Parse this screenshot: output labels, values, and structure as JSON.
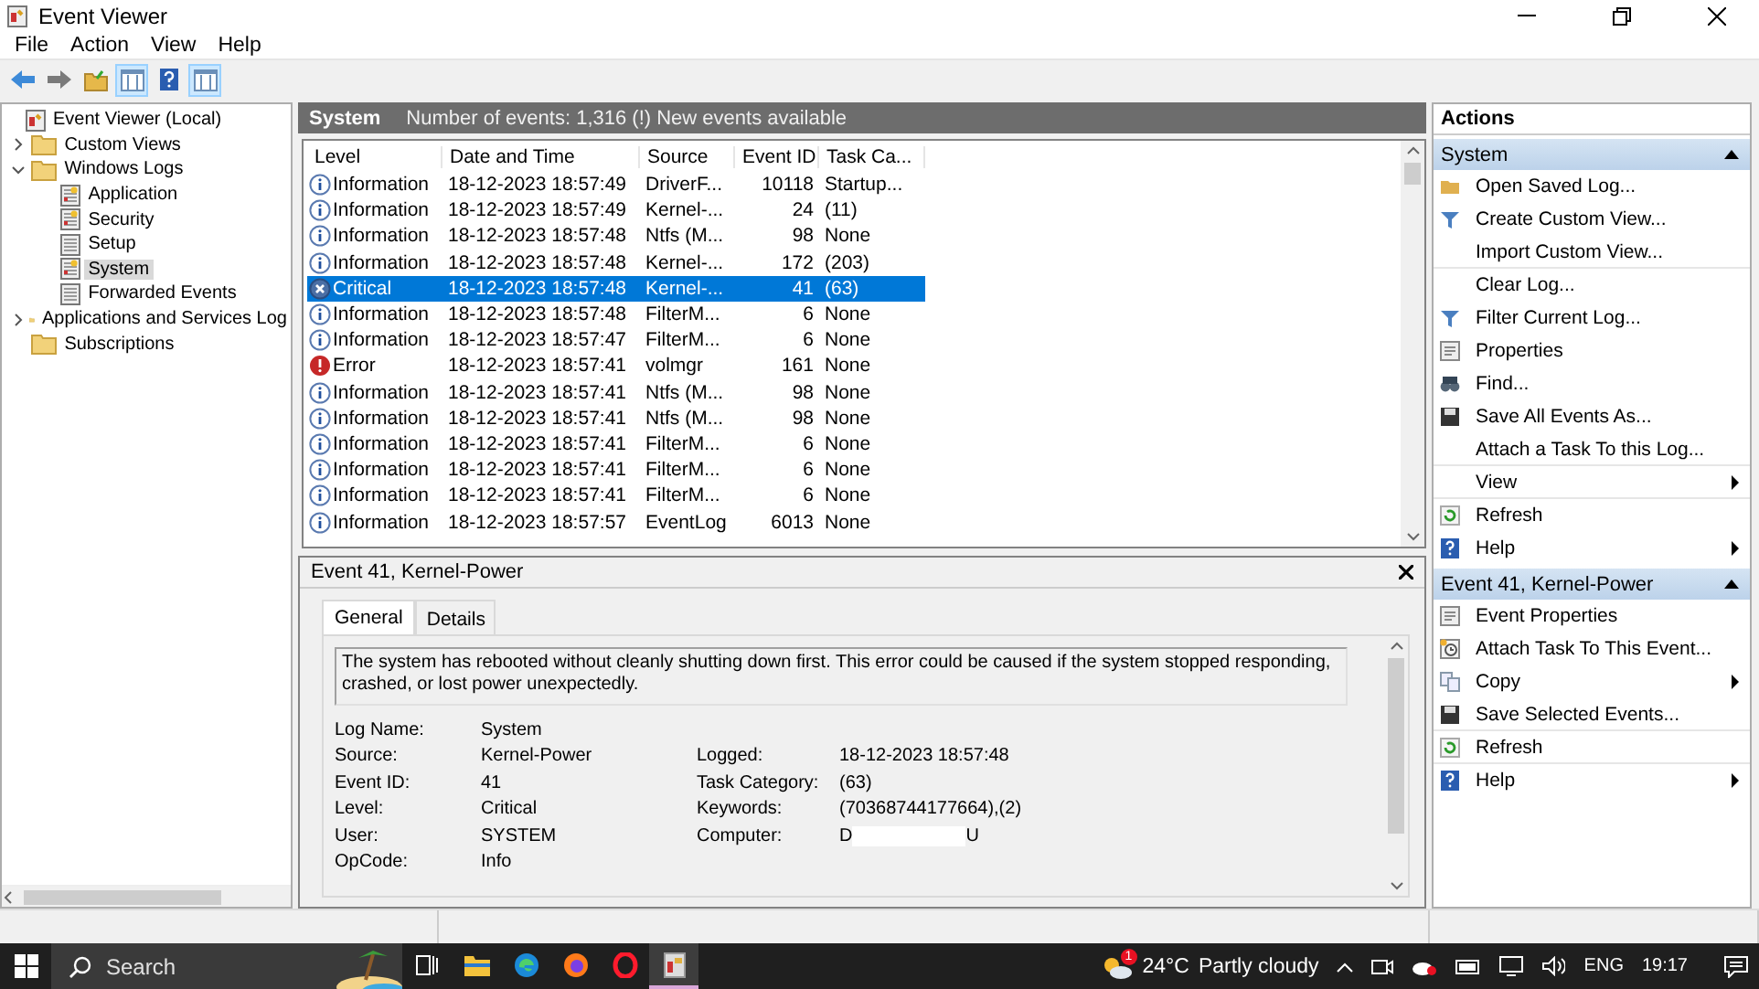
{
  "window": {
    "title": "Event Viewer"
  },
  "menu": [
    {
      "label": "File"
    },
    {
      "label": "Action"
    },
    {
      "label": "View"
    },
    {
      "label": "Help"
    }
  ],
  "toolbar": [
    {
      "kind": "back",
      "pressed": false
    },
    {
      "kind": "forward",
      "pressed": false
    },
    {
      "kind": "folder",
      "pressed": false
    },
    {
      "kind": "pane",
      "pressed": true
    },
    {
      "kind": "help",
      "pressed": false
    },
    {
      "kind": "pane",
      "pressed": true
    }
  ],
  "tree": [
    {
      "label": "Event Viewer (Local)",
      "kind": "root",
      "selected": false,
      "children": [
        {
          "label": "Custom Views",
          "kind": "folder",
          "expanded": false,
          "selected": false
        },
        {
          "label": "Windows Logs",
          "kind": "folder",
          "expanded": true,
          "selected": false,
          "children": [
            {
              "label": "Application",
              "kind": "log",
              "selected": false
            },
            {
              "label": "Security",
              "kind": "log",
              "selected": false
            },
            {
              "label": "Setup",
              "kind": "plain",
              "selected": false
            },
            {
              "label": "System",
              "kind": "log",
              "selected": true
            },
            {
              "label": "Forwarded Events",
              "kind": "plain",
              "selected": false
            }
          ]
        },
        {
          "label": "Applications and Services Log",
          "kind": "folder",
          "expanded": false,
          "selected": false
        },
        {
          "label": "Subscriptions",
          "kind": "folder",
          "selected": false
        }
      ]
    }
  ],
  "log_header": {
    "title": "System",
    "summary": "Number of events: 1,316 (!) New events available"
  },
  "table": {
    "columns": [
      "Level",
      "Date and Time",
      "Source",
      "Event ID",
      "Task Ca..."
    ],
    "rows": [
      {
        "kind": "information",
        "level": "Information",
        "date": "18-12-2023 18:57:49",
        "source": "DriverF...",
        "event_id": "10118",
        "task": "Startup...",
        "selected": false
      },
      {
        "kind": "information",
        "level": "Information",
        "date": "18-12-2023 18:57:49",
        "source": "Kernel-...",
        "event_id": "24",
        "task": "(11)",
        "selected": false
      },
      {
        "kind": "information",
        "level": "Information",
        "date": "18-12-2023 18:57:48",
        "source": "Ntfs (M...",
        "event_id": "98",
        "task": "None",
        "selected": false
      },
      {
        "kind": "information",
        "level": "Information",
        "date": "18-12-2023 18:57:48",
        "source": "Kernel-...",
        "event_id": "172",
        "task": "(203)",
        "selected": false
      },
      {
        "kind": "critical",
        "level": "Critical",
        "date": "18-12-2023 18:57:48",
        "source": "Kernel-...",
        "event_id": "41",
        "task": "(63)",
        "selected": true
      },
      {
        "kind": "information",
        "level": "Information",
        "date": "18-12-2023 18:57:48",
        "source": "FilterM...",
        "event_id": "6",
        "task": "None",
        "selected": false
      },
      {
        "kind": "information",
        "level": "Information",
        "date": "18-12-2023 18:57:47",
        "source": "FilterM...",
        "event_id": "6",
        "task": "None",
        "selected": false
      },
      {
        "kind": "error",
        "level": "Error",
        "date": "18-12-2023 18:57:41",
        "source": "volmgr",
        "event_id": "161",
        "task": "None",
        "selected": false
      },
      {
        "kind": "information",
        "level": "Information",
        "date": "18-12-2023 18:57:41",
        "source": "Ntfs (M...",
        "event_id": "98",
        "task": "None",
        "selected": false
      },
      {
        "kind": "information",
        "level": "Information",
        "date": "18-12-2023 18:57:41",
        "source": "Ntfs (M...",
        "event_id": "98",
        "task": "None",
        "selected": false
      },
      {
        "kind": "information",
        "level": "Information",
        "date": "18-12-2023 18:57:41",
        "source": "FilterM...",
        "event_id": "6",
        "task": "None",
        "selected": false
      },
      {
        "kind": "information",
        "level": "Information",
        "date": "18-12-2023 18:57:41",
        "source": "FilterM...",
        "event_id": "6",
        "task": "None",
        "selected": false
      },
      {
        "kind": "information",
        "level": "Information",
        "date": "18-12-2023 18:57:41",
        "source": "FilterM...",
        "event_id": "6",
        "task": "None",
        "selected": false
      },
      {
        "kind": "information",
        "level": "Information",
        "date": "18-12-2023 18:57:57",
        "source": "EventLog",
        "event_id": "6013",
        "task": "None",
        "selected": false
      }
    ]
  },
  "details": {
    "title": "Event 41, Kernel-Power",
    "tabs": [
      {
        "label": "General",
        "selected": true
      },
      {
        "label": "Details",
        "selected": false
      }
    ],
    "message": "The system has rebooted without cleanly shutting down first. This error could be caused if the system stopped responding, crashed, or lost power unexpectedly.",
    "rows": [
      {
        "left": {
          "label": "Log Name:",
          "value": "System"
        }
      },
      {
        "left": {
          "label": "Source:",
          "value": "Kernel-Power"
        },
        "right": {
          "label": "Logged:",
          "value": "18-12-2023 18:57:48"
        }
      },
      {
        "left": {
          "label": "Event ID:",
          "value": "41"
        },
        "right": {
          "label": "Task Category:",
          "value": "(63)"
        }
      },
      {
        "left": {
          "label": "Level:",
          "value": "Critical"
        },
        "right": {
          "label": "Keywords:",
          "value": "(70368744177664),(2)"
        }
      },
      {
        "left": {
          "label": "User:",
          "value": "SYSTEM"
        },
        "right": {
          "label": "Computer:",
          "value": "D",
          "redacted": true,
          "value_end": "U"
        }
      },
      {
        "left": {
          "label": "OpCode:",
          "value": "Info"
        }
      }
    ]
  },
  "actions": {
    "title": "Actions",
    "sections": [
      {
        "title": "System",
        "expanded": true,
        "items": [
          {
            "label": "Open Saved Log...",
            "kind": "open",
            "submenu": false,
            "divider": false
          },
          {
            "label": "Create Custom View...",
            "kind": "filter",
            "submenu": false,
            "divider": false
          },
          {
            "label": "Import Custom View...",
            "kind": "none",
            "submenu": false,
            "divider": true
          },
          {
            "label": "Clear Log...",
            "kind": "none",
            "submenu": false,
            "divider": false
          },
          {
            "label": "Filter Current Log...",
            "kind": "filter",
            "submenu": false,
            "divider": false
          },
          {
            "label": "Properties",
            "kind": "properties",
            "submenu": false,
            "divider": false
          },
          {
            "label": "Find...",
            "kind": "find",
            "submenu": false,
            "divider": false
          },
          {
            "label": "Save All Events As...",
            "kind": "save",
            "submenu": false,
            "divider": false
          },
          {
            "label": "Attach a Task To this Log...",
            "kind": "none",
            "submenu": false,
            "divider": true
          },
          {
            "label": "View",
            "kind": "none",
            "submenu": true,
            "divider": true
          },
          {
            "label": "Refresh",
            "kind": "refresh",
            "submenu": false,
            "divider": false
          },
          {
            "label": "Help",
            "kind": "help",
            "submenu": true,
            "divider": false
          }
        ]
      },
      {
        "title": "Event 41, Kernel-Power",
        "expanded": true,
        "items": [
          {
            "label": "Event Properties",
            "kind": "properties",
            "submenu": false,
            "divider": false
          },
          {
            "label": "Attach Task To This Event...",
            "kind": "task",
            "submenu": false,
            "divider": false
          },
          {
            "label": "Copy",
            "kind": "copy",
            "submenu": true,
            "divider": false
          },
          {
            "label": "Save Selected Events...",
            "kind": "save",
            "submenu": false,
            "divider": true
          },
          {
            "label": "Refresh",
            "kind": "refresh",
            "submenu": false,
            "divider": true
          },
          {
            "label": "Help",
            "kind": "help",
            "submenu": true,
            "divider": false
          }
        ]
      }
    ]
  },
  "taskbar": {
    "search_placeholder": "Search",
    "apps": [
      {
        "kind": "task-view",
        "selected": false
      },
      {
        "kind": "folder",
        "selected": false
      },
      {
        "kind": "edge",
        "selected": false
      },
      {
        "kind": "firefox",
        "selected": false
      },
      {
        "kind": "opera",
        "selected": false
      },
      {
        "kind": "event-viewer",
        "selected": true
      }
    ],
    "weather": {
      "badge": "1",
      "temperature": "24°C",
      "condition": "Partly cloudy"
    },
    "language": "ENG",
    "time": "19:17"
  }
}
